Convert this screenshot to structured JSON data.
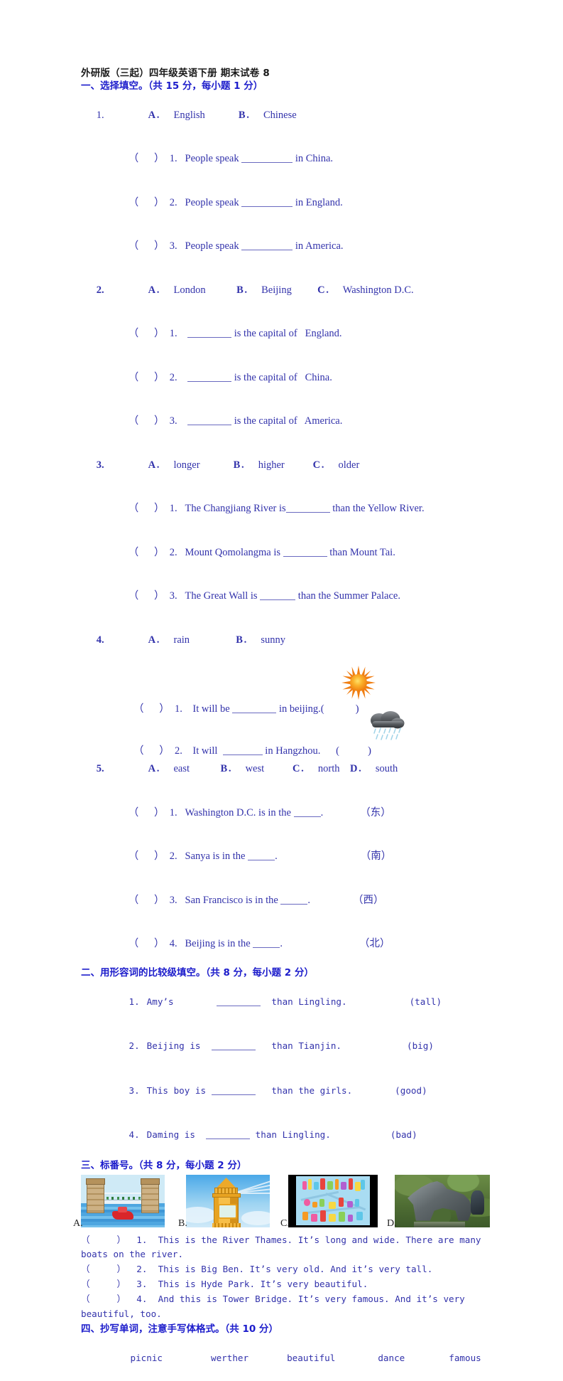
{
  "document": {
    "title": "外研版（三起）四年级英语下册 期末试卷 8"
  },
  "section1": {
    "heading": "一、选择填空。（共 15 分，每小题 1 分）",
    "questions": [
      {
        "number": "1.",
        "options": "A． English                B．  Chinese",
        "items": [
          "（      ）  1.   People speak ",
          "（      ）  2.   People speak ",
          "（      ）  3.   People speak "
        ],
        "tails": [
          " in China.",
          " in England.",
          " in America."
        ]
      },
      {
        "number": "2.",
        "options": "A． London              B．  Beijing          C．  Washington D.C.",
        "items": [
          "（      ）  1.    ",
          "（      ）  2.    ",
          "（      ）  3.    "
        ],
        "tails": [
          " is the capital of   England.",
          " is the capital of   China.",
          " is the capital of   America."
        ]
      },
      {
        "number": "3.",
        "options": "A． longer                 B．  higher            C．  older",
        "items": [
          "（      ）  1.   The Changjiang River is",
          "（      ）  2.   Mount Qomolangma is ",
          "（      ）  3.   The Great Wall is "
        ],
        "tails": [
          " than the Yellow River.",
          " than Mount Tai.",
          " than the Summer Palace."
        ]
      },
      {
        "number": "4.",
        "options": "A． rain                      B．  sunny",
        "items": [
          "（      ）  1.    It will be ",
          "（      ）  2.    It will  "
        ],
        "tails": [
          " in beijing.(",
          " in Hangzhou.      ("
        ]
      },
      {
        "number": "5.",
        "options": "A．  east              B．   west               C．   north     D．   south",
        "items": [
          "（      ）  1.   Washington D.C. is in the ",
          "（      ）  2.   Sanya is in the ",
          "（      ）  3.   San Francisco is in the ",
          "（      ）  4.   Beijing is in the "
        ],
        "tails": [
          ".",
          ".",
          ".",
          "."
        ],
        "hints": [
          "（东）",
          "（南）",
          "（西）",
          "（北）"
        ]
      }
    ],
    "icons": {
      "sun": "sun-icon",
      "rain": "rain-cloud-icon",
      "paren_open": "(",
      "paren_close": ")"
    }
  },
  "section2": {
    "heading": "二、用形容词的比较级填空。（共 8 分，每小题 2 分）",
    "items": [
      {
        "num": "1.",
        "before": "Amy’s        ",
        "after": "  than Lingling.",
        "hint": "(tall)"
      },
      {
        "num": "2.",
        "before": "Beijing is  ",
        "after": "   than Tianjin.",
        "hint": "(big)"
      },
      {
        "num": "3.",
        "before": "This boy is ",
        "after": "   than the girls.",
        "hint": "(good)"
      },
      {
        "num": "4.",
        "before": "Daming is  ",
        "after": " than Lingling.",
        "hint": "(bad)"
      }
    ]
  },
  "section3": {
    "heading": "三、标番号。（共 8 分，每小题 2 分）",
    "pictures": [
      {
        "label": "A.",
        "name": "tower-bridge-picture"
      },
      {
        "label": "B.",
        "name": "big-ben-picture"
      },
      {
        "label": "C.",
        "name": "park-map-picture"
      },
      {
        "label": "D.",
        "name": "equestrian-statue-picture"
      }
    ],
    "items": [
      "（     ）  1.  This is the River Thames. It’s long and wide. There are many",
      "boats on the river.",
      "（     ）  2.  This is Big Ben. It’s very old. And it’s very tall.",
      "（     ）  3.  This is Hyde Park. It’s very beautiful.",
      "（     ）  4.  And this is Tower Bridge. It’s very famous. And it’s very",
      "beautiful, too."
    ]
  },
  "section4": {
    "heading": "四、抄写单词，注意手写体格式。（共 10 分）",
    "words": [
      "picnic",
      "werther",
      "beautiful",
      "dance",
      "famous"
    ]
  },
  "colors": {
    "heading_blue": "#1c1ccb",
    "body_blue": "#3232ab",
    "title_black": "#1a1a1a",
    "blank_rule": "#6a6ac0"
  }
}
